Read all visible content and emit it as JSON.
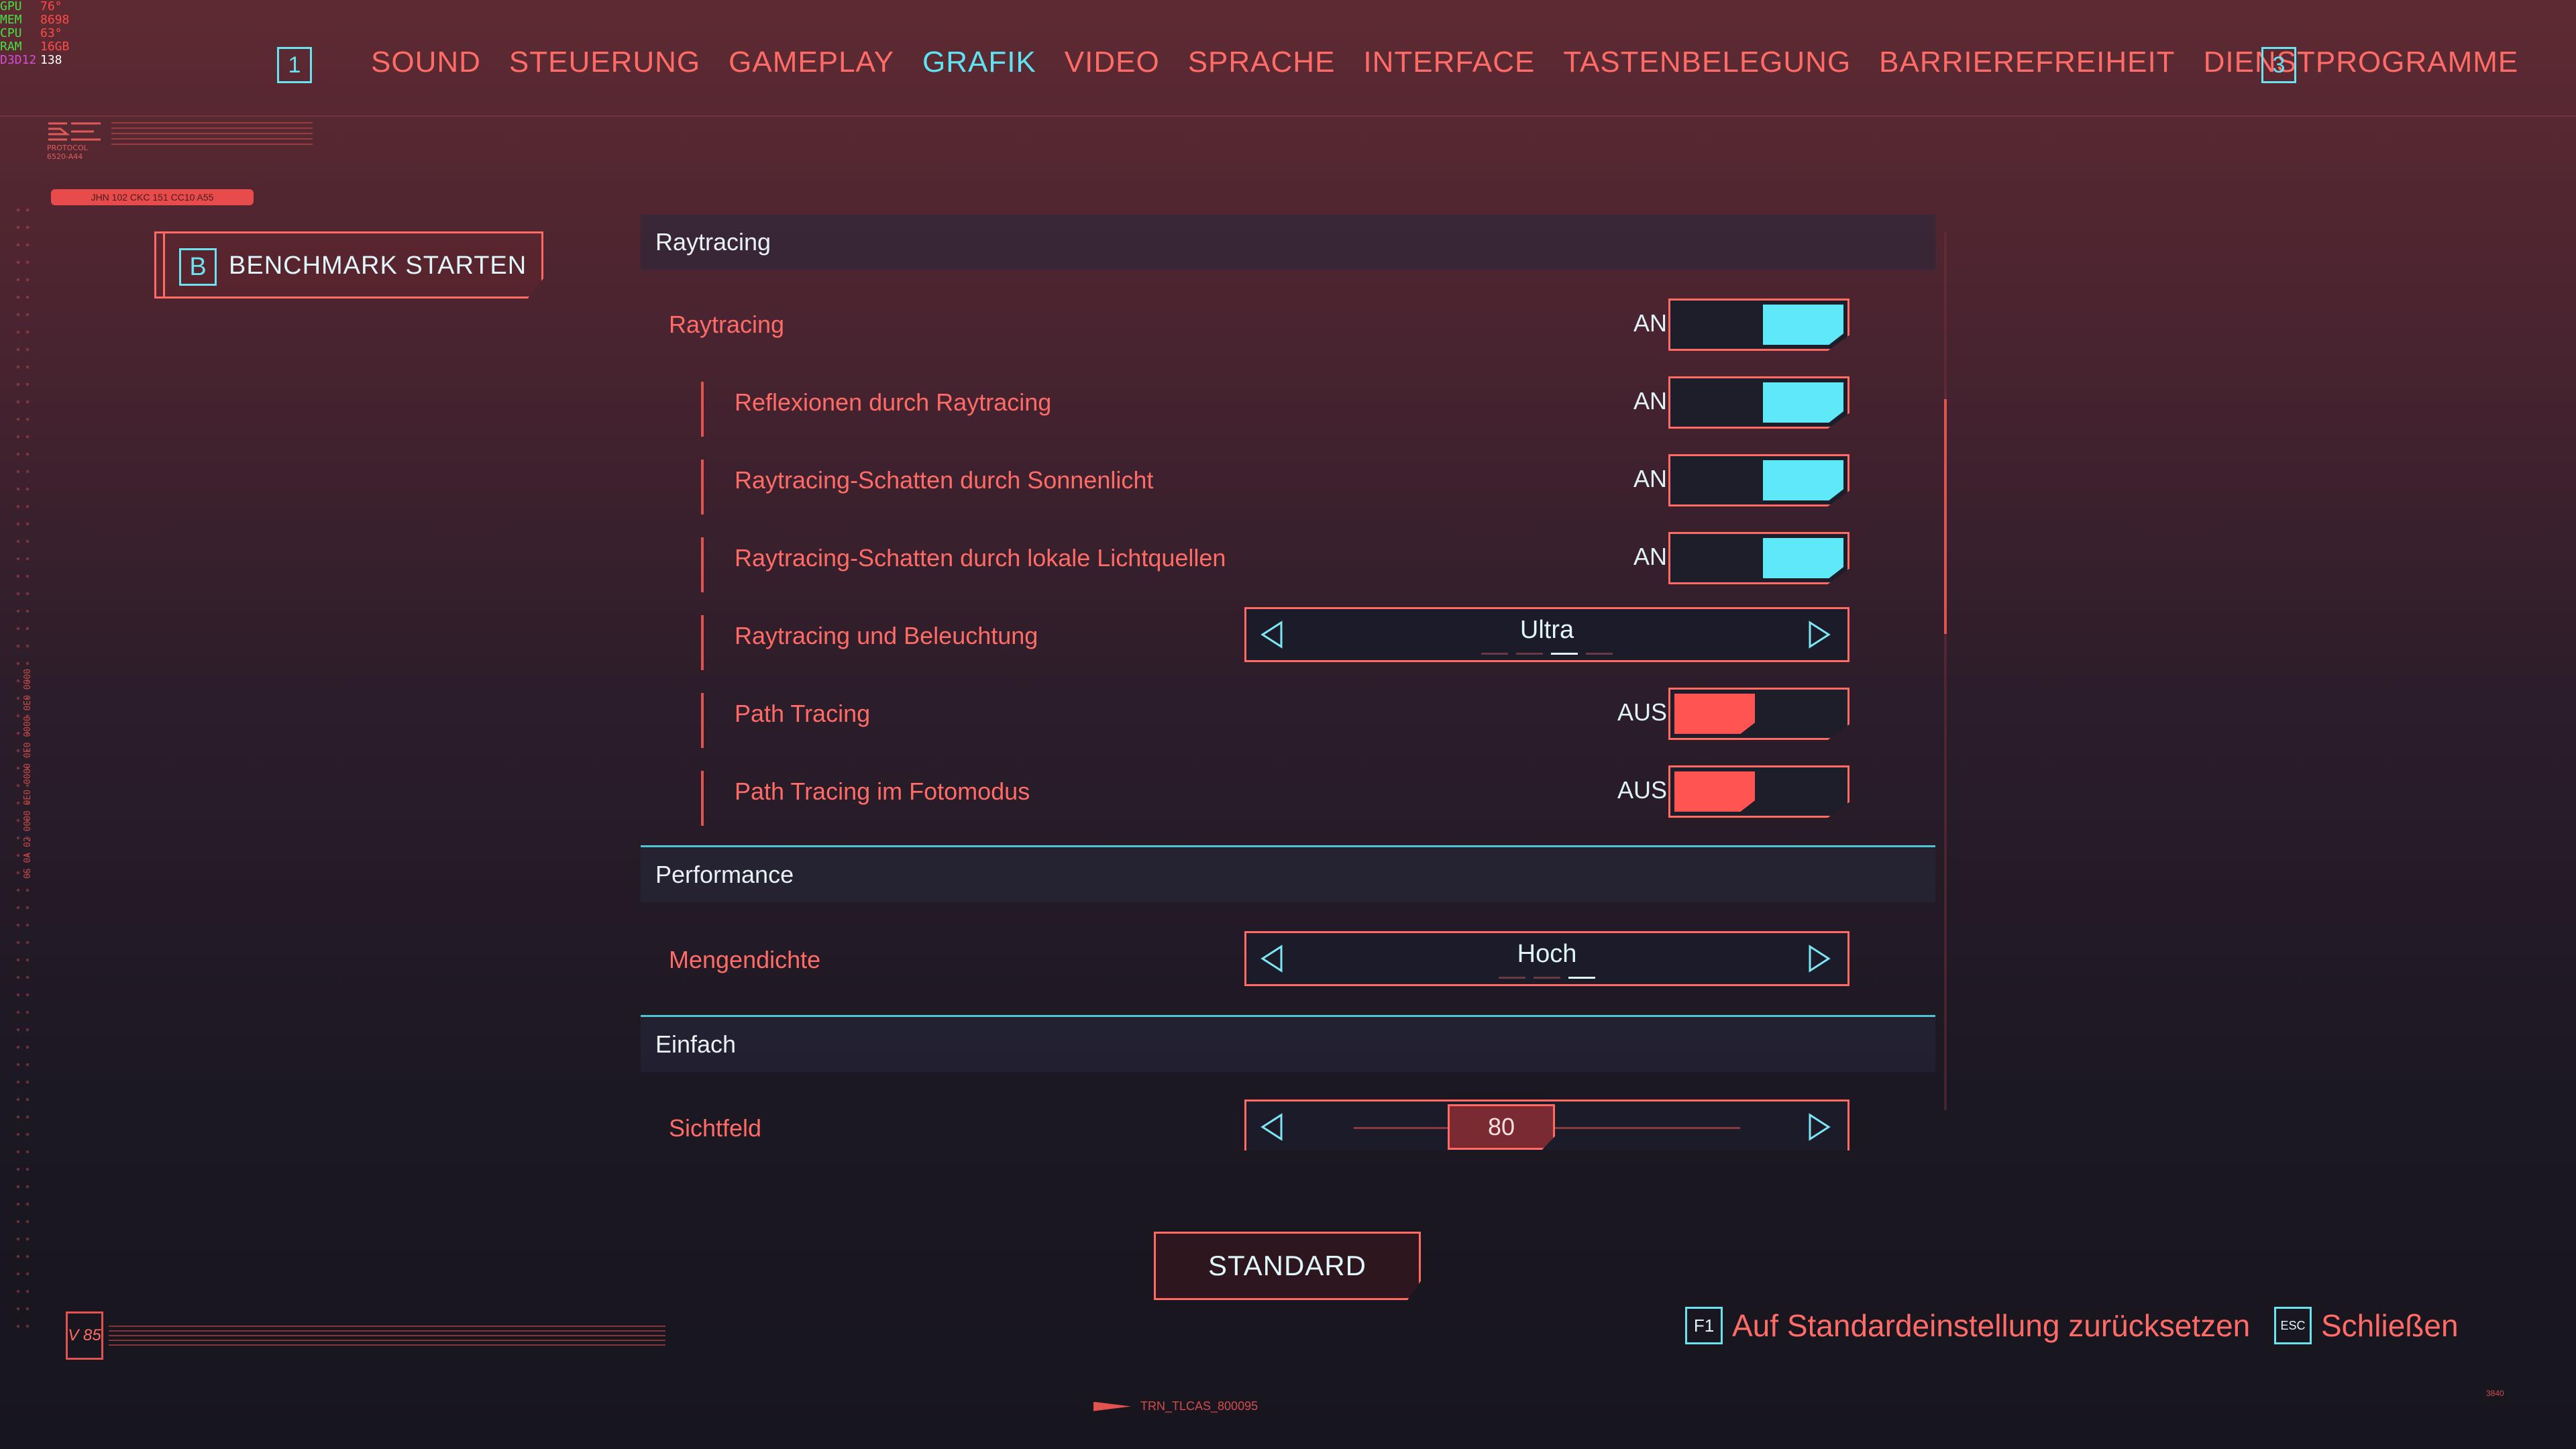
{
  "perf": [
    {
      "key": "GPU",
      "value": "76°",
      "color": "#46e046"
    },
    {
      "key": "MEM",
      "value": "8698",
      "color": "#46e046"
    },
    {
      "key": "CPU",
      "value": "63°",
      "color": "#46e046"
    },
    {
      "key": "RAM",
      "value": "16GB",
      "color": "#46e046"
    },
    {
      "key": "D3D12",
      "value": "138",
      "color": "#d64dd6"
    }
  ],
  "nav": {
    "prev_key": "1",
    "next_key": "3",
    "tabs": [
      "SOUND",
      "STEUERUNG",
      "GAMEPLAY",
      "GRAFIK",
      "VIDEO",
      "SPRACHE",
      "INTERFACE",
      "TASTENBELEGUNG",
      "BARRIEREFREIHEIT",
      "DIENSTPROGRAMME"
    ],
    "active": "GRAFIK"
  },
  "deco": {
    "protocol": "PROTOCOL 6520-A44",
    "tag": "JHN 102 CKC 151 CC10 A55",
    "vertical": "0S 0A 02 0000 0E0 0000 0E0 0000 0E0 0000"
  },
  "benchmark": {
    "key": "B",
    "label": "BENCHMARK STARTEN"
  },
  "sections": {
    "raytracing": "Raytracing",
    "performance": "Performance",
    "einfach": "Einfach"
  },
  "settings": {
    "raytracing": {
      "label": "Raytracing",
      "state": "AN"
    },
    "reflexionen": {
      "label": "Reflexionen durch Raytracing",
      "state": "AN"
    },
    "sonnenlicht": {
      "label": "Raytracing-Schatten durch Sonnenlicht",
      "state": "AN"
    },
    "lokale": {
      "label": "Raytracing-Schatten durch lokale Lichtquellen",
      "state": "AN"
    },
    "beleuchtung": {
      "label": "Raytracing und Beleuchtung",
      "value": "Ultra",
      "option_index": 3,
      "option_count": 4
    },
    "pathtracing": {
      "label": "Path Tracing",
      "state": "AUS"
    },
    "fotomodus": {
      "label": "Path Tracing im Fotomodus",
      "state": "AUS"
    },
    "mengendichte": {
      "label": "Mengendichte",
      "value": "Hoch",
      "option_index": 3,
      "option_count": 3
    },
    "sichtfeld": {
      "label": "Sichtfeld",
      "value": "80"
    }
  },
  "bottom": {
    "standard": "STANDARD",
    "reset_key": "F1",
    "reset_label": "Auf Standardeinstellung zurücksetzen",
    "close_key": "ESC",
    "close_label": "Schließen",
    "version": "V 85",
    "trn": "TRN_TLCAS_800095",
    "corner": "3840"
  },
  "colors": {
    "accent_cyan": "#5ee8f8",
    "accent_red": "#ff5452",
    "text_red": "#ff6b66"
  }
}
